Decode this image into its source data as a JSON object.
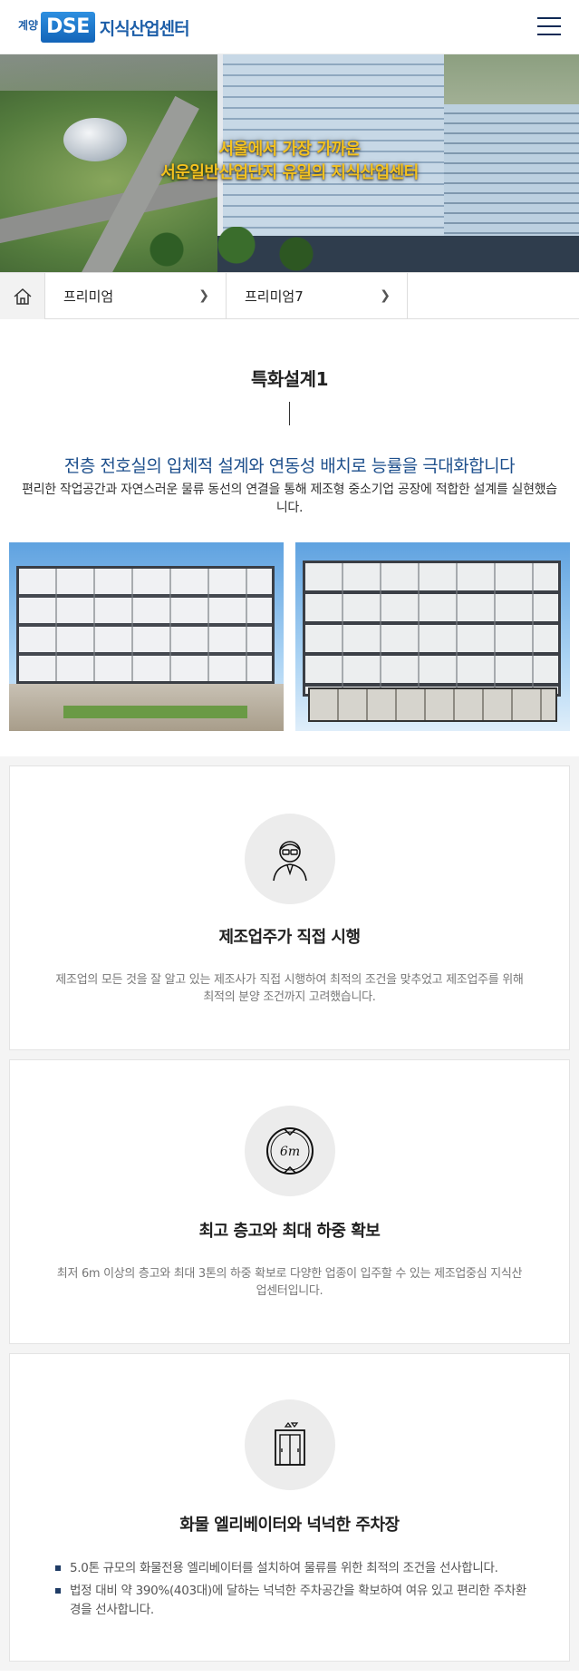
{
  "header": {
    "logo_sub": "계양",
    "logo_box": "DSE",
    "logo_name": "지식산업센터"
  },
  "hero": {
    "line1": "서울에서 가장 가까운",
    "line2": "서운일반산업단지 유일의 지식산업센터"
  },
  "breadcrumb": {
    "items": [
      {
        "label": "프리미엄"
      },
      {
        "label": "프리미엄7"
      }
    ]
  },
  "section": {
    "title": "특화설계1",
    "lead_main": "전층 전호실의 입체적 설계와 연동성 배치로 능률을 극대화합니다",
    "lead_sub": "편리한 작업공간과 자연스러운 물류 동선의 연결을 통해 제조형 중소기업 공장에 적합한 설계를 실현했습니다."
  },
  "cards": [
    {
      "title": "제조업주가 직접 시행",
      "text": "제조업의 모든 것을 잘 알고 있는 제조사가 직접 시행하여 최적의 조건을 맞추었고 제조업주를 위해 최적의 분양 조건까지 고려했습니다."
    },
    {
      "title": "최고 층고와 최대 하중 확보",
      "icon_label": "6m",
      "text": "최저 6m 이상의 층고와 최대 3톤의 하중 확보로 다양한 업종이 입주할 수 있는 제조업중심 지식산업센터입니다."
    },
    {
      "title": "화물 엘리베이터와 넉넉한 주차장",
      "bullets": [
        "5.0톤 규모의 화물전용 엘리베이터를 설치하여 물류를 위한 최적의 조건을 선사합니다.",
        "법정 대비 약 390%(403대)에 달하는 넉넉한 주차공간을 확보하여 여유 있고 편리한 주차환경을 선사합니다."
      ]
    }
  ]
}
